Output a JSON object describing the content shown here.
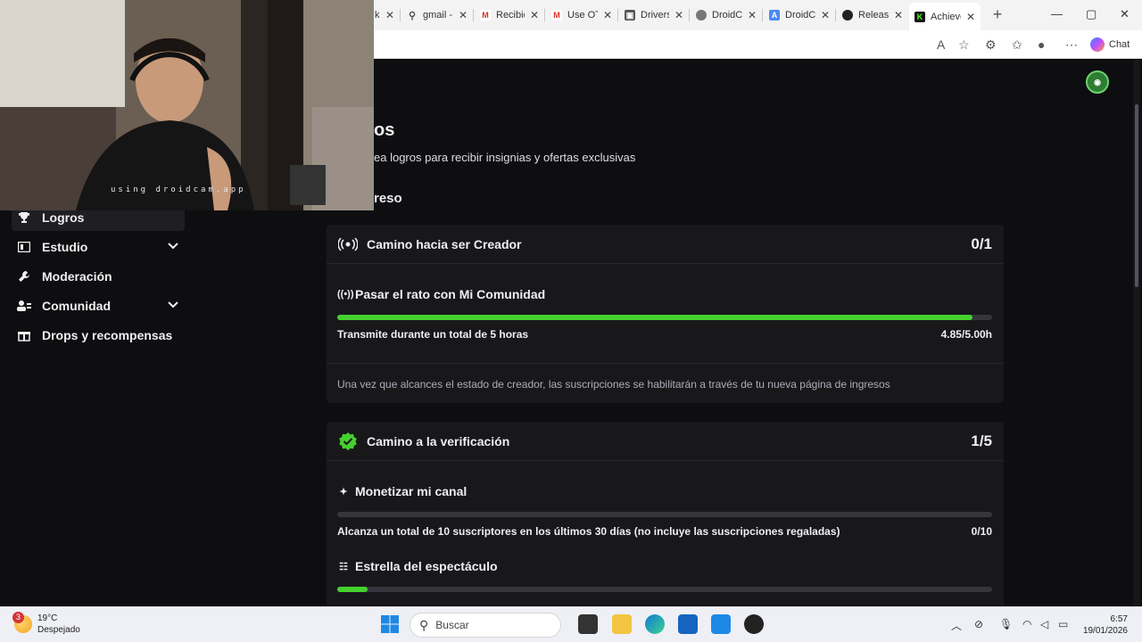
{
  "browser": {
    "tabs": [
      {
        "label": "k",
        "icon": "twitch-icon"
      },
      {
        "label": "gmail -",
        "icon": "search-icon"
      },
      {
        "label": "Recibid",
        "icon": "gmail-icon"
      },
      {
        "label": "Use OTI",
        "icon": "gmail-icon"
      },
      {
        "label": "Drivers",
        "icon": "drivers-icon"
      },
      {
        "label": "DroidCa",
        "icon": "droidcam-icon"
      },
      {
        "label": "DroidCa",
        "icon": "droidcam-icon"
      },
      {
        "label": "Release",
        "icon": "github-icon"
      },
      {
        "label": "Achieve",
        "icon": "kick-icon",
        "active": true
      }
    ],
    "chat_label": "Chat"
  },
  "page": {
    "title": "os",
    "subtitle": "ea logros para recibir insignias y ofertas exclusivas",
    "section": "reso"
  },
  "sidebar": {
    "items": [
      {
        "label": "Logros",
        "icon": "trophy-icon",
        "active": true
      },
      {
        "label": "Estudio",
        "icon": "studio-icon",
        "expandable": true
      },
      {
        "label": "Moderación",
        "icon": "wrench-icon"
      },
      {
        "label": "Comunidad",
        "icon": "community-icon",
        "expandable": true
      },
      {
        "label": "Drops y recompensas",
        "icon": "gift-icon"
      }
    ]
  },
  "cards": {
    "creator": {
      "title": "Camino hacia ser Creador",
      "count": "0/1",
      "achievement": {
        "title": "Pasar el rato con Mi Comunidad",
        "requirement": "Transmite durante un total de 5 horas",
        "value": "4.85/5.00h",
        "progress": 0.97
      },
      "note": "Una vez que alcances el estado de creador, las suscripciones se habilitarán a través de tu nueva página de ingresos"
    },
    "verification": {
      "title": "Camino a la verificación",
      "count": "1/5",
      "achievements": [
        {
          "title": "Monetizar mi canal",
          "requirement": "Alcanza un total de 10 suscriptores en los últimos 30 días (no incluye las suscripciones regaladas)",
          "value": "0/10",
          "progress": 0.0
        },
        {
          "title": "Estrella del espectáculo",
          "progress": 0.046
        }
      ]
    }
  },
  "webcam": {
    "watermark": "using droidcam.app"
  },
  "taskbar": {
    "weather_temp": "19°C",
    "weather_desc": "Despejado",
    "weather_badge": "3",
    "search_placeholder": "Buscar",
    "time": "6:57",
    "date": "19/01/2026"
  },
  "colors": {
    "progress": "#45d12e",
    "card": "#18181b",
    "background": "#0e0e10"
  }
}
